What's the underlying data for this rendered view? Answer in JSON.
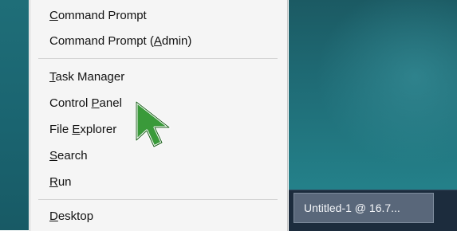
{
  "menu": {
    "items": [
      {
        "label": "Command Prompt",
        "mnemonic": "C"
      },
      {
        "label": "Command Prompt (Admin)",
        "mnemonic": "A"
      },
      {
        "label": "Task Manager",
        "mnemonic": "T"
      },
      {
        "label": "Control Panel",
        "mnemonic": "P"
      },
      {
        "label": "File Explorer",
        "mnemonic": "E"
      },
      {
        "label": "Search",
        "mnemonic": "S"
      },
      {
        "label": "Run",
        "mnemonic": "R"
      },
      {
        "label": "Desktop",
        "mnemonic": "D"
      }
    ]
  },
  "taskbar": {
    "button_label": "Untitled-1 @ 16.7..."
  },
  "colors": {
    "menu_bg": "#f5f5f5",
    "desktop": "#1f6c76",
    "taskbar": "#1c2c3d",
    "cursor": "#3a9a3a"
  },
  "cursor_icon": "arrow-pointer-icon"
}
